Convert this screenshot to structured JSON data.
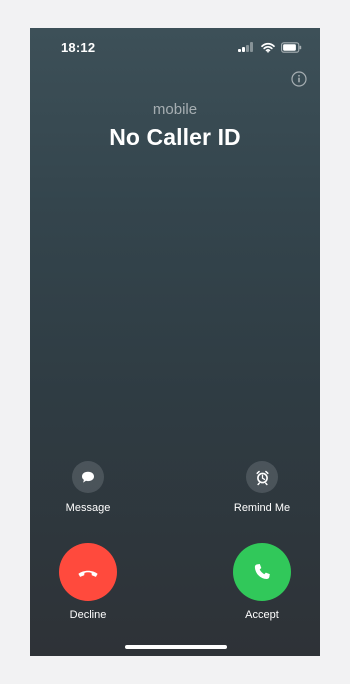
{
  "status_bar": {
    "time": "18:12",
    "signal_icon": "cellular-signal-icon",
    "wifi_icon": "wifi-icon",
    "battery_icon": "battery-icon",
    "battery_level": 0.8
  },
  "call": {
    "caller_type": "mobile",
    "caller_name": "No Caller ID",
    "info_icon": "info-icon"
  },
  "actions": {
    "message": {
      "label": "Message",
      "icon": "message-icon"
    },
    "remind_me": {
      "label": "Remind Me",
      "icon": "alarm-clock-icon"
    },
    "decline": {
      "label": "Decline",
      "icon": "phone-down-icon",
      "color": "#ff4a3d"
    },
    "accept": {
      "label": "Accept",
      "icon": "phone-icon",
      "color": "#31c85a"
    }
  }
}
